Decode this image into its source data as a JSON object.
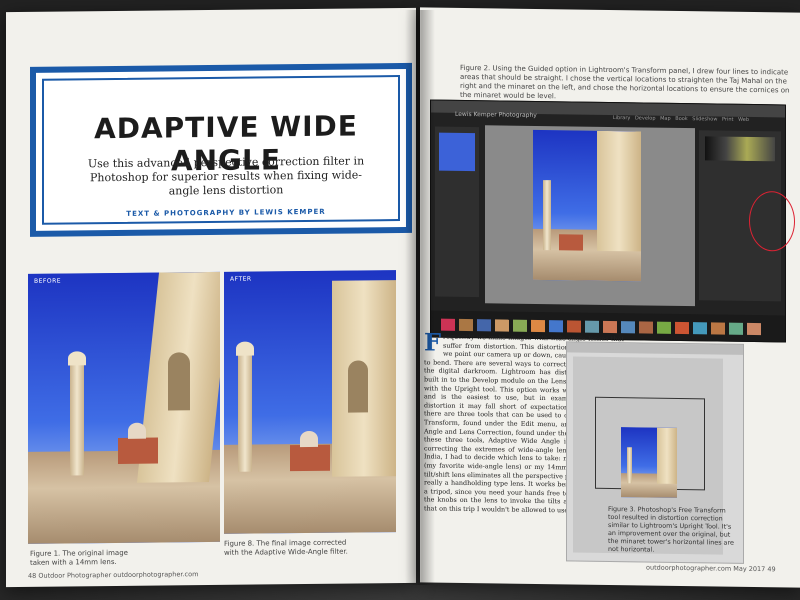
{
  "article": {
    "title": "ADAPTIVE WIDE ANGLE",
    "subtitle": "Use this advanced perspective correction filter in Photoshop for superior results when fixing wide-angle lens distortion",
    "byline": "TEXT & PHOTOGRAPHY BY LEWIS KEMPER"
  },
  "figures": {
    "before_label": "BEFORE",
    "after_label": "AFTER",
    "fig1_caption": "Figure 1. The original image taken with a 14mm lens.",
    "fig8_caption": "Figure 8. The final image corrected with the Adaptive Wide-Angle filter.",
    "fig2_caption": "Figure 2. Using the Guided option in Lightroom's Transform panel, I drew four lines to indicate areas that should be straight. I chose the vertical locations to straighten the Taj Mahal on the right and the minaret on the left, and chose the horizontal locations to ensure the cornices on the minaret would be level.",
    "fig3_caption": "Figure 3. Photoshop's Free Transform tool resulted in distortion correction similar to Lightroom's Upright Tool. It's an improvement over the original, but the minaret tower's horizontal lines are not horizontal."
  },
  "lightroom": {
    "brand": "Lewis Kemper Photography",
    "menu": "Library Develop Map Book Slideshow Print Web"
  },
  "body_text": "requently we make images with wide-angle lenses that suffer from distortion. This distortion is caused when we point our camera up or down, causing vertical lines to bend. There are several ways to correct this distortion in the digital darkroom. Lightroom has distortion correction built in to the Develop module on the Lens Correction panel with the Upright tool. This option works well in most cases and is the easiest to use, but in examples of extreme distortion it may fall short of expectations. In Photoshop, there are three tools that can be used to correct distortion: Transform, found under the Edit menu, and Adaptive Wide Angle and Lens Correction, found under the Filters menu. Of these three tools, Adaptive Wide Angle is best suited for correcting the extremes of wide-angle lenses. On a trip to India, I had to decide which lens to take: my 17mm tilt/shift (my favorite wide-angle lens) or my 14mm wide angle. The tilt/shift lens eliminates all the perspective problems but isn't really a handholding type lens. It works best when you're on a tripod, since you need your hands free to physically move the knobs on the lens to invoke the tilts and shifts. I knew that on this trip I wouldn't be allowed to use a tripod at most",
  "dropcap": "F",
  "footer": {
    "left_page": "48 Outdoor Photographer outdoorphotographer.com",
    "right_page": "outdoorphotographer.com May 2017 49"
  },
  "colors": {
    "accent": "#1b5aa8",
    "sky": "#2b4fd6"
  }
}
